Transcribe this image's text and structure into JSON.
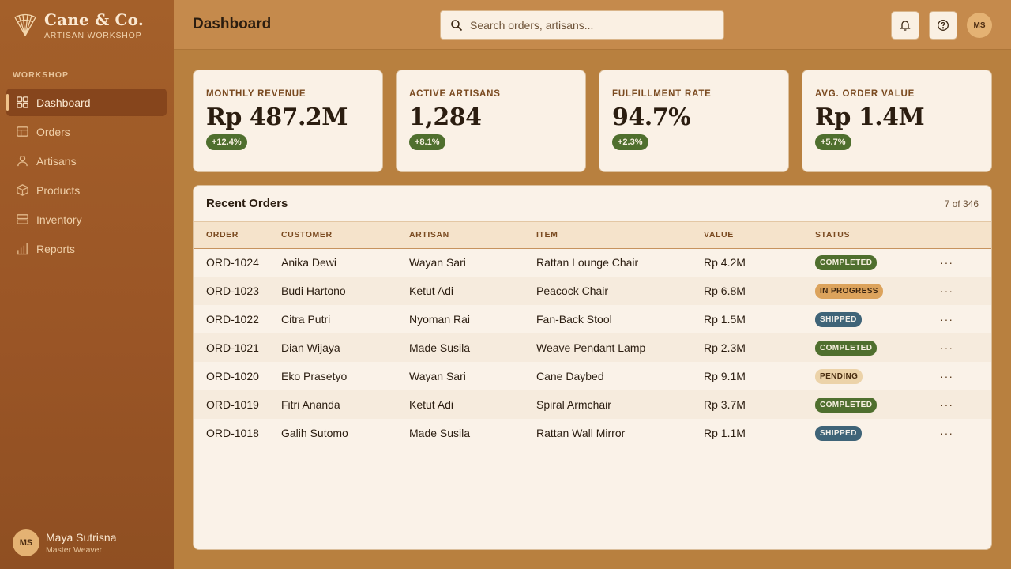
{
  "brand": {
    "name": "Cane & Co.",
    "subtitle": "ARTISAN WORKSHOP",
    "logo_icon": "fan-logo-icon"
  },
  "sidebar": {
    "section_label": "WORKSHOP",
    "items": [
      {
        "label": "Dashboard",
        "icon": "grid-icon",
        "active": true
      },
      {
        "label": "Orders",
        "icon": "table-icon",
        "active": false
      },
      {
        "label": "Artisans",
        "icon": "person-icon",
        "active": false
      },
      {
        "label": "Products",
        "icon": "box-icon",
        "active": false
      },
      {
        "label": "Inventory",
        "icon": "stack-icon",
        "active": false
      },
      {
        "label": "Reports",
        "icon": "bar-chart-icon",
        "active": false
      }
    ],
    "user": {
      "initials": "MS",
      "name": "Maya Sutrisna",
      "role": "Master Weaver"
    }
  },
  "header": {
    "title": "Dashboard",
    "search_placeholder": "Search orders, artisans...",
    "avatar_initials": "MS"
  },
  "kpis": [
    {
      "label": "MONTHLY REVENUE",
      "value": "Rp 487.2M",
      "delta": "+12.4%"
    },
    {
      "label": "ACTIVE ARTISANS",
      "value": "1,284",
      "delta": "+8.1%"
    },
    {
      "label": "FULFILLMENT RATE",
      "value": "94.7%",
      "delta": "+2.3%"
    },
    {
      "label": "AVG. ORDER VALUE",
      "value": "Rp 1.4M",
      "delta": "+5.7%"
    }
  ],
  "orders": {
    "title": "Recent Orders",
    "count": "7 of 346",
    "columns": [
      "ORDER",
      "CUSTOMER",
      "ARTISAN",
      "ITEM",
      "VALUE",
      "STATUS"
    ],
    "rows": [
      {
        "order": "ORD-1024",
        "customer": "Anika Dewi",
        "artisan": "Wayan Sari",
        "item": "Rattan Lounge Chair",
        "value": "Rp 4.2M",
        "status": "COMPLETED"
      },
      {
        "order": "ORD-1023",
        "customer": "Budi Hartono",
        "artisan": "Ketut Adi",
        "item": "Peacock Chair",
        "value": "Rp 6.8M",
        "status": "IN PROGRESS"
      },
      {
        "order": "ORD-1022",
        "customer": "Citra Putri",
        "artisan": "Nyoman Rai",
        "item": "Fan-Back Stool",
        "value": "Rp 1.5M",
        "status": "SHIPPED"
      },
      {
        "order": "ORD-1021",
        "customer": "Dian Wijaya",
        "artisan": "Made Susila",
        "item": "Weave Pendant Lamp",
        "value": "Rp 2.3M",
        "status": "COMPLETED"
      },
      {
        "order": "ORD-1020",
        "customer": "Eko Prasetyo",
        "artisan": "Wayan Sari",
        "item": "Cane Daybed",
        "value": "Rp 9.1M",
        "status": "PENDING"
      },
      {
        "order": "ORD-1019",
        "customer": "Fitri Ananda",
        "artisan": "Ketut Adi",
        "item": "Spiral Armchair",
        "value": "Rp 3.7M",
        "status": "COMPLETED"
      },
      {
        "order": "ORD-1018",
        "customer": "Galih Sutomo",
        "artisan": "Made Susila",
        "item": "Rattan Wall Mirror",
        "value": "Rp 1.1M",
        "status": "SHIPPED"
      }
    ],
    "row_action": "···"
  },
  "status_colors": {
    "COMPLETED": {
      "bg": "#4f6f2e",
      "fg": "#f7f0e0"
    },
    "IN PROGRESS": {
      "bg": "#dca35c",
      "fg": "#3a2410"
    },
    "SHIPPED": {
      "bg": "#3f6478",
      "fg": "#f2f0ea"
    },
    "PENDING": {
      "bg": "#ecd3a9",
      "fg": "#4a2e12"
    }
  }
}
